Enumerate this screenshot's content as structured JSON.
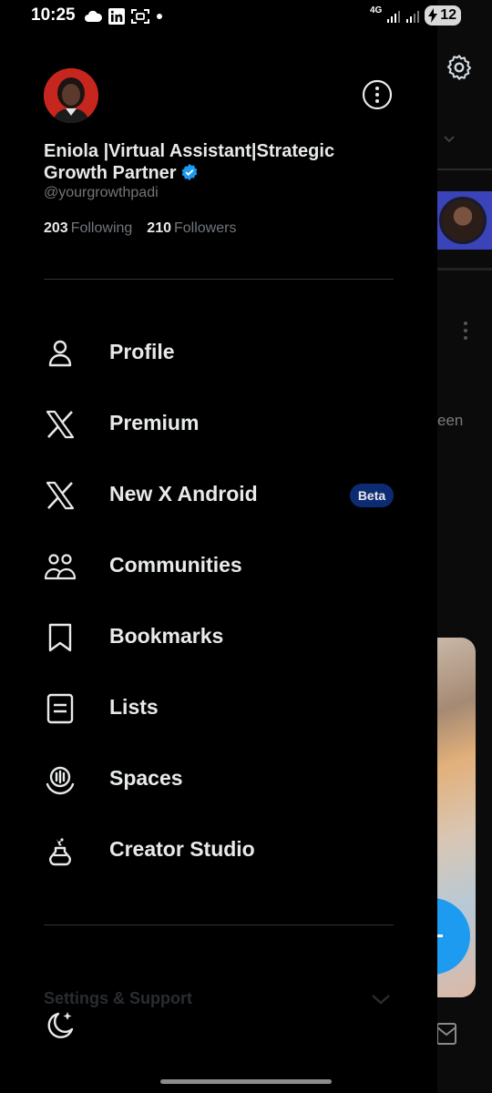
{
  "status_bar": {
    "time": "10:25",
    "network": "4G",
    "battery": "12",
    "icons": [
      "cloud-icon",
      "linkedin-icon",
      "screenshot-icon",
      "dot-icon"
    ]
  },
  "profile": {
    "name": "Eniola |Virtual Assistant|Strategic Growth Partner",
    "handle": "@yourgrowthpadi",
    "following_count": "203",
    "following_label": "Following",
    "followers_count": "210",
    "followers_label": "Followers",
    "verified": true
  },
  "menu": {
    "items": [
      {
        "label": "Profile",
        "icon": "person-icon"
      },
      {
        "label": "Premium",
        "icon": "x-logo-icon"
      },
      {
        "label": "New X Android",
        "icon": "x-logo-icon",
        "badge": "Beta"
      },
      {
        "label": "Communities",
        "icon": "communities-icon"
      },
      {
        "label": "Bookmarks",
        "icon": "bookmark-icon"
      },
      {
        "label": "Lists",
        "icon": "lists-icon"
      },
      {
        "label": "Spaces",
        "icon": "spaces-icon"
      },
      {
        "label": "Creator Studio",
        "icon": "flask-icon"
      }
    ]
  },
  "settings_section": {
    "label": "Settings & Support"
  },
  "background": {
    "partial_text": "een"
  },
  "colors": {
    "background": "#000000",
    "text_primary": "#e7e9ea",
    "text_secondary": "#71767b",
    "accent_blue": "#1d9bf0",
    "beta_badge": "#0d2b73",
    "divider": "#2f3336"
  }
}
